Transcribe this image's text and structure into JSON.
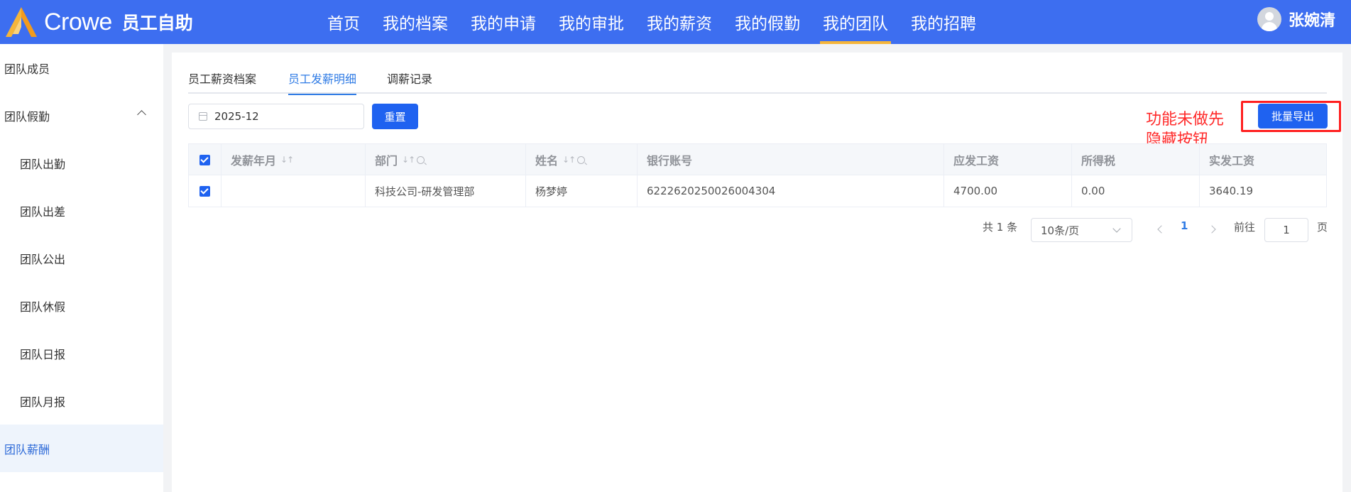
{
  "header": {
    "brand": "Crowe",
    "app_name": "员工自助",
    "nav": [
      "首页",
      "我的档案",
      "我的申请",
      "我的审批",
      "我的薪资",
      "我的假勤",
      "我的团队",
      "我的招聘"
    ],
    "active_nav": "我的团队",
    "user_name": "张婉清"
  },
  "sidebar": {
    "items": [
      {
        "label": "团队成员"
      },
      {
        "label": "团队假勤"
      },
      {
        "label": "团队出勤"
      },
      {
        "label": "团队出差"
      },
      {
        "label": "团队公出"
      },
      {
        "label": "团队休假"
      },
      {
        "label": "团队日报"
      },
      {
        "label": "团队月报"
      },
      {
        "label": "团队薪酬"
      }
    ],
    "active": "团队薪酬"
  },
  "tabs": [
    "员工薪资档案",
    "员工发薪明细",
    "调薪记录"
  ],
  "active_tab": "员工发薪明细",
  "toolbar": {
    "date_value": "2025-12",
    "reset_label": "重置",
    "export_label": "批量导出"
  },
  "annotation": {
    "line1": "功能未做先",
    "line2": "隐藏按钮"
  },
  "table": {
    "columns": [
      "发薪年月",
      "部门",
      "姓名",
      "银行账号",
      "应发工资",
      "所得税",
      "实发工资"
    ],
    "sort_glyph": "↓↑",
    "rows": [
      {
        "pay_month": "",
        "department": "科技公司-研发管理部",
        "name": "杨梦婷",
        "bank_account": "6222620250026004304",
        "gross_pay": "4700.00",
        "tax": "0.00",
        "net_pay": "3640.19"
      }
    ]
  },
  "pagination": {
    "total": "共 1 条",
    "page_size": "10条/页",
    "current_page": "1",
    "goto_label": "前往",
    "goto_value": "1",
    "page_unit": "页"
  },
  "colors": {
    "header_bg": "#3d6ef0",
    "active_underline": "#f5b53a",
    "primary": "#1f62f0",
    "link": "#2f7be5",
    "annotation_red": "#ff1f1f"
  }
}
